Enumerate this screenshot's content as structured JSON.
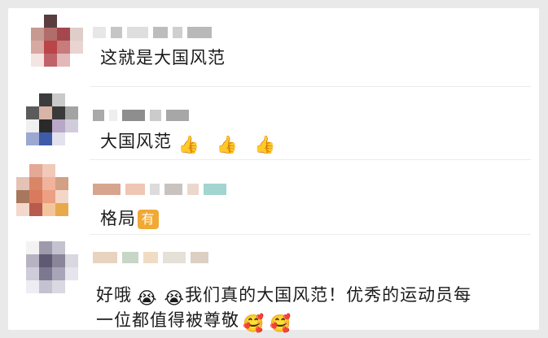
{
  "comments": [
    {
      "text": "这就是大国风范",
      "emojis": []
    },
    {
      "text": "大国风范",
      "emojis": [
        "👍",
        "👍",
        "👍"
      ]
    },
    {
      "text": "格局",
      "badge": "有"
    },
    {
      "line1_text": "好哦",
      "line1_emojis": [
        "😭",
        "😭"
      ],
      "line1_rest": "我们真的大国风范！优秀的运动员每",
      "line2_text": "一位都值得被尊敬",
      "line2_emojis": [
        "🥰",
        "🥰"
      ]
    }
  ],
  "colors": {
    "background": "#e9e9e9",
    "card": "#ffffff",
    "text": "#1b1b1b",
    "badge": "#f0a935"
  },
  "icons": {
    "thumbs_up": "thumbs-up-icon",
    "crying_face": "crying-face-icon",
    "hugging_face": "smiling-hearts-icon"
  }
}
